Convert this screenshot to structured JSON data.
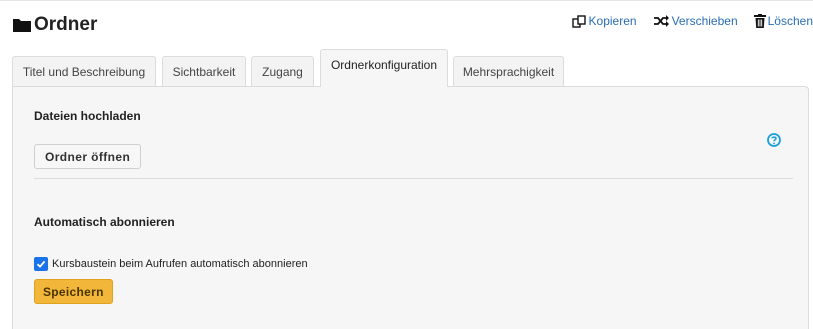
{
  "header": {
    "title": "Ordner",
    "title_icon": "folder-icon",
    "actions": [
      {
        "label": "Kopieren",
        "icon": "copy-icon"
      },
      {
        "label": "Verschieben",
        "icon": "shuffle-icon"
      },
      {
        "label": "Löschen",
        "icon": "trash-icon"
      }
    ]
  },
  "tabs": [
    {
      "label": "Titel und Beschreibung",
      "active": false
    },
    {
      "label": "Sichtbarkeit",
      "active": false
    },
    {
      "label": "Zugang",
      "active": false
    },
    {
      "label": "Ordnerkonfiguration",
      "active": true
    },
    {
      "label": "Mehrsprachigkeit",
      "active": false
    }
  ],
  "upload": {
    "title": "Dateien hochladen",
    "open_button": "Ordner öffnen",
    "help_icon": "help-icon"
  },
  "subscribe": {
    "title": "Automatisch abonnieren",
    "checkbox_label": "Kursbaustein beim Aufrufen automatisch abonnieren",
    "checked": true
  },
  "save_button": "Speichern",
  "colors": {
    "link": "#2a6db3",
    "accent_save": "#f2b73a",
    "checkbox": "#1a73e8",
    "help": "#1a9fd9"
  }
}
